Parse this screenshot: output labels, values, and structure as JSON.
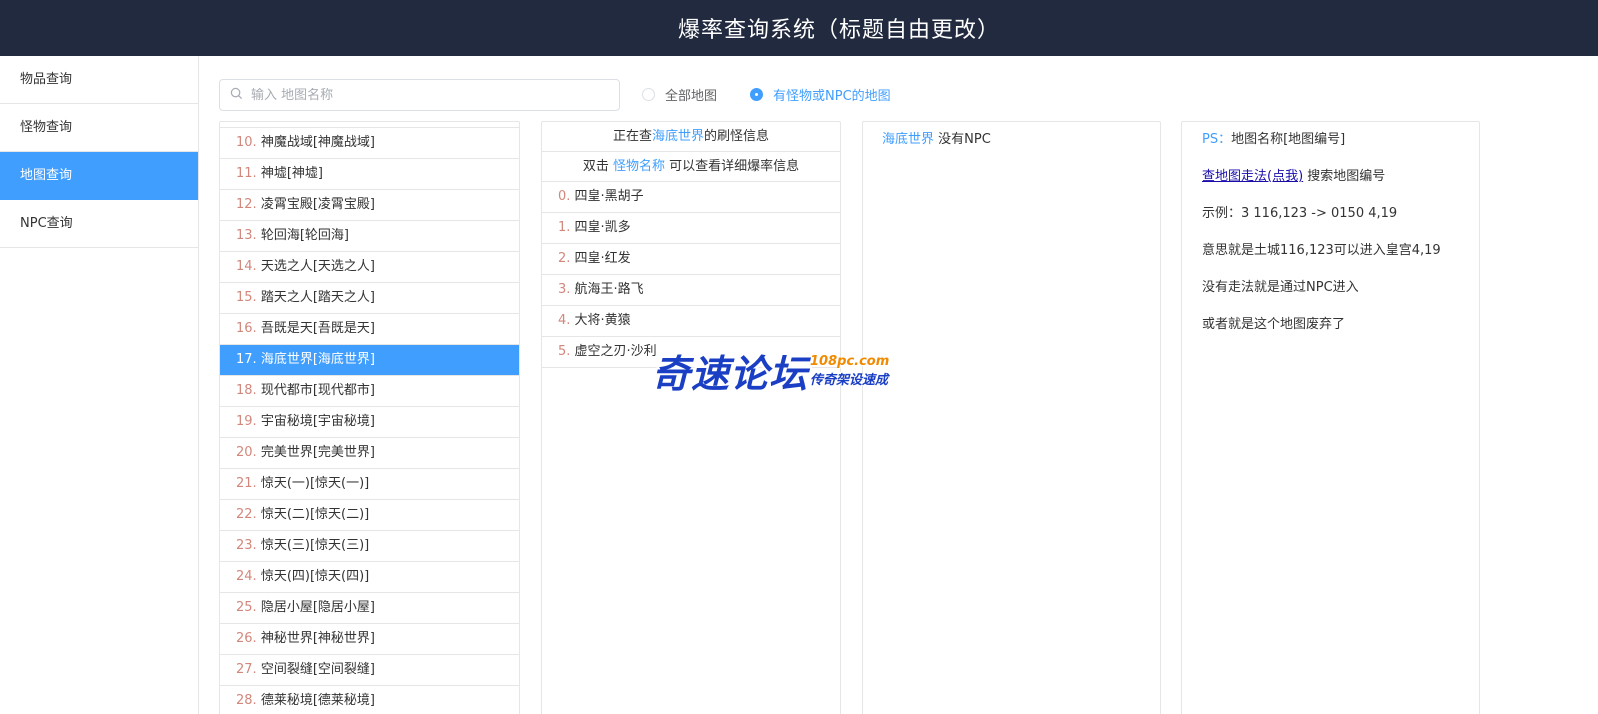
{
  "header": {
    "title": "爆率查询系统（标题自由更改）"
  },
  "sidebar": {
    "items": [
      {
        "label": "物品查询"
      },
      {
        "label": "怪物查询"
      },
      {
        "label": "地图查询"
      },
      {
        "label": "NPC查询"
      }
    ],
    "active_index": 2
  },
  "search": {
    "placeholder": "输入 地图名称",
    "value": ""
  },
  "filter": {
    "options": [
      {
        "label": "全部地图",
        "checked": false
      },
      {
        "label": "有怪物或NPC的地图",
        "checked": true
      }
    ]
  },
  "map_list": {
    "items": [
      {
        "num": "10.",
        "name": "神魔战域[神魔战域]"
      },
      {
        "num": "11.",
        "name": "神墟[神墟]"
      },
      {
        "num": "12.",
        "name": "凌霄宝殿[凌霄宝殿]"
      },
      {
        "num": "13.",
        "name": "轮回海[轮回海]"
      },
      {
        "num": "14.",
        "name": "天选之人[天选之人]"
      },
      {
        "num": "15.",
        "name": "踏天之人[踏天之人]"
      },
      {
        "num": "16.",
        "name": "吾既是天[吾既是天]"
      },
      {
        "num": "17.",
        "name": "海底世界[海底世界]"
      },
      {
        "num": "18.",
        "name": "现代都市[现代都市]"
      },
      {
        "num": "19.",
        "name": "宇宙秘境[宇宙秘境]"
      },
      {
        "num": "20.",
        "name": "完美世界[完美世界]"
      },
      {
        "num": "21.",
        "name": "惊天(一)[惊天(一)]"
      },
      {
        "num": "22.",
        "name": "惊天(二)[惊天(二)]"
      },
      {
        "num": "23.",
        "name": "惊天(三)[惊天(三)]"
      },
      {
        "num": "24.",
        "name": "惊天(四)[惊天(四)]"
      },
      {
        "num": "25.",
        "name": "隐居小屋[隐居小屋]"
      },
      {
        "num": "26.",
        "name": "神秘世界[神秘世界]"
      },
      {
        "num": "27.",
        "name": "空间裂缝[空间裂缝]"
      },
      {
        "num": "28.",
        "name": "德莱秘境[德莱秘境]"
      }
    ],
    "active_index": 7
  },
  "monster_panel": {
    "line1_prefix": "正在查",
    "line1_map": "海底世界",
    "line1_suffix": "的刷怪信息",
    "line2_prefix": "双击",
    "line2_link": "怪物名称",
    "line2_suffix": "可以查看详细爆率信息",
    "monsters": [
      {
        "num": "0.",
        "name": "四皇·黑胡子"
      },
      {
        "num": "1.",
        "name": "四皇·凯多"
      },
      {
        "num": "2.",
        "name": "四皇·红发"
      },
      {
        "num": "3.",
        "name": "航海王·路飞"
      },
      {
        "num": "4.",
        "name": "大将·黄猿"
      },
      {
        "num": "5.",
        "name": "虚空之刃·沙利"
      }
    ]
  },
  "npc_panel": {
    "map": "海底世界",
    "text": "没有NPC"
  },
  "info_panel": {
    "ps_label": "PS：",
    "ps_text": "地图名称[地图编号]",
    "link": "查地图走法(点我)",
    "link_suffix": "搜索地图编号",
    "example": "示例：3 116,123 -> 0150 4,19",
    "meaning": "意思就是土城116,123可以进入皇宫4,19",
    "note1": "没有走法就是通过NPC进入",
    "note2": "或者就是这个地图废弃了"
  },
  "watermark": {
    "big": "奇速论坛",
    "url": "108pc.com",
    "slogan": "传奇架设速成"
  },
  "colors": {
    "header_bg": "#212a3f",
    "accent": "#409eff",
    "index_num": "#d2877c"
  }
}
